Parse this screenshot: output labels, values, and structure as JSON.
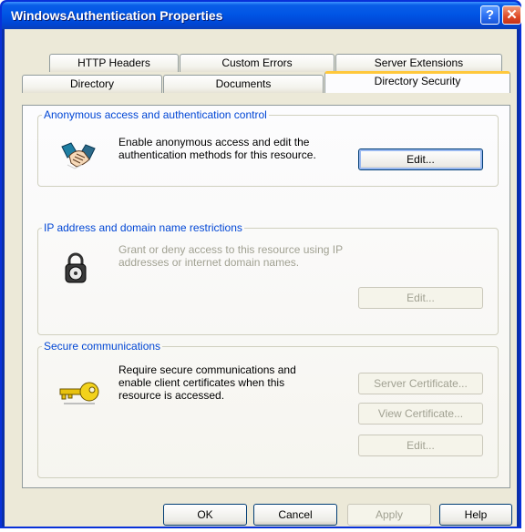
{
  "window": {
    "title": "WindowsAuthentication Properties",
    "help_glyph": "?",
    "close_glyph": "✕"
  },
  "tabs": {
    "row_back": [
      "HTTP Headers",
      "Custom Errors",
      "Server Extensions"
    ],
    "row_front": [
      "Directory",
      "Documents",
      "Directory Security"
    ],
    "active": "Directory Security"
  },
  "groups": {
    "anonymous": {
      "title": "Anonymous access and authentication control",
      "description": "Enable anonymous access and edit the authentication methods for this resource.",
      "edit_label": "Edit..."
    },
    "ip": {
      "title": "IP address and domain name restrictions",
      "description": "Grant or deny access to this resource using IP addresses or internet domain names.",
      "edit_label": "Edit..."
    },
    "secure": {
      "title": "Secure communications",
      "description": "Require secure communications and enable client certificates when this resource is accessed.",
      "server_cert_label": "Server Certificate...",
      "view_cert_label": "View Certificate...",
      "edit_label": "Edit..."
    }
  },
  "footer": {
    "ok": "OK",
    "cancel": "Cancel",
    "apply": "Apply",
    "help": "Help"
  },
  "icons": {
    "anonymous": "handshake-icon",
    "ip": "padlock-icon",
    "secure": "key-icon"
  },
  "colors": {
    "title_bar": "#0055e5",
    "dialog_face": "#ece9d8",
    "group_title": "#0046d5",
    "active_tab_highlight": "#ffc83c"
  }
}
